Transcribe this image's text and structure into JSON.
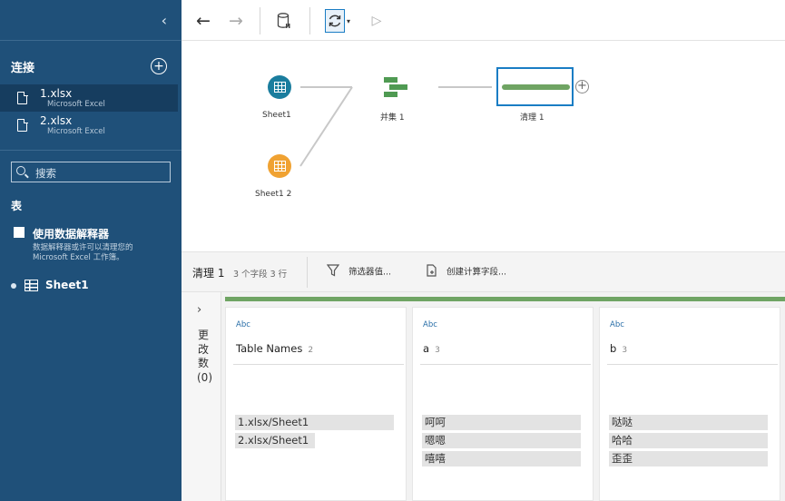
{
  "sidebar": {
    "collapse_icon": "chevron-left-icon",
    "connections_title": "连接",
    "connections": [
      {
        "name": "1.xlsx",
        "type": "Microsoft Excel",
        "selected": true
      },
      {
        "name": "2.xlsx",
        "type": "Microsoft Excel",
        "selected": false
      }
    ],
    "search_placeholder": "搜索",
    "tables_title": "表",
    "interpreter_label": "使用数据解释器",
    "interpreter_desc": "数据解释器或许可以清理您的 Microsoft Excel 工作簿。",
    "sheet_name": "Sheet1"
  },
  "toolbar": {
    "back": "←",
    "forward": "→",
    "run": "▷"
  },
  "flow": {
    "nodes": [
      {
        "label": "Sheet1",
        "color": "#1a7d9e"
      },
      {
        "label": "Sheet1 2",
        "color": "#f0a232"
      },
      {
        "label": "并集 1",
        "color": "#4f9a52"
      },
      {
        "label": "清理 1",
        "color": "#6fa463"
      }
    ],
    "add_symbol": "+"
  },
  "panel": {
    "title": "清理 1",
    "meta": "3 个字段  3 行",
    "filter_label": "筛选器值...",
    "calc_label": "创建计算字段...",
    "changes_chevron": "›",
    "changes_label": "更改数(0)"
  },
  "profiles": [
    {
      "type": "Abc",
      "name": "Table Names",
      "count": "2",
      "values": [
        "1.xlsx/Sheet1",
        "2.xlsx/Sheet1"
      ]
    },
    {
      "type": "Abc",
      "name": "a",
      "count": "3",
      "values": [
        "呵呵",
        "嗯嗯",
        "嘻嘻"
      ]
    },
    {
      "type": "Abc",
      "name": "b",
      "count": "3",
      "values": [
        "哒哒",
        "哈哈",
        "歪歪"
      ]
    }
  ]
}
